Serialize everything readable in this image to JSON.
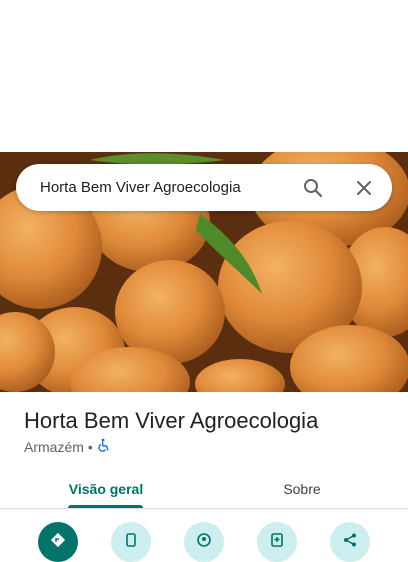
{
  "search": {
    "value": "Horta Bem Viver Agroecologia"
  },
  "place": {
    "name": "Horta Bem Viver Agroecologia",
    "category": "Armazém",
    "separator": "•",
    "accessibility_icon": "wheelchair-icon"
  },
  "tabs": [
    {
      "label": "Visão geral",
      "active": true
    },
    {
      "label": "Sobre",
      "active": false
    }
  ],
  "actions": [
    {
      "icon": "directions-icon"
    },
    {
      "icon": "phone-icon"
    },
    {
      "icon": "location-pin-icon"
    },
    {
      "icon": "add-document-icon"
    },
    {
      "icon": "share-icon"
    }
  ],
  "colors": {
    "accent": "#00736b",
    "action_bg": "#cdeeee",
    "accessibility_icon": "#1a73e8"
  },
  "photo": {
    "subject": "oranges"
  }
}
